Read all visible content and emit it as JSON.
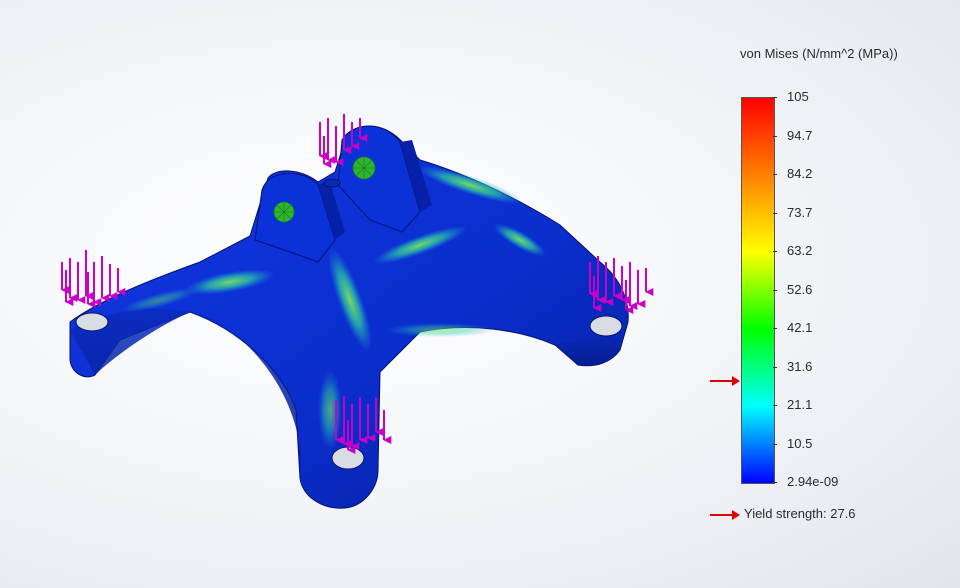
{
  "legend": {
    "title": "von Mises (N/mm^2 (MPa))",
    "ticks": [
      "105",
      "94.7",
      "84.2",
      "73.7",
      "63.2",
      "52.6",
      "42.1",
      "31.6",
      "21.1",
      "10.5",
      "2.94e-09"
    ],
    "max": 105,
    "min": 2.94e-09,
    "yield_value": 27.6,
    "yield_label": "Yield strength: 27.6",
    "colors": [
      "#ff0000",
      "#ff8000",
      "#ffff00",
      "#00ff00",
      "#00ffff",
      "#0000ff"
    ]
  },
  "model": {
    "base_color": "#0a2fd0",
    "load_arrow_color": "#c800c8",
    "fixture_color": "#2fb52f"
  }
}
